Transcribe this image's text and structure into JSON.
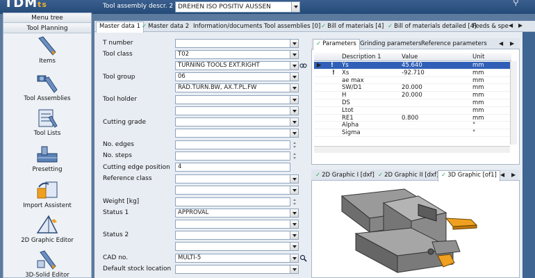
{
  "app": {
    "logo": "TDM",
    "logo_sub": "ts"
  },
  "header": {
    "assembly_label": "Tool assembly descr. 2",
    "assembly_value": "DREHEN ISO POSITIV AUSSEN"
  },
  "sidebar": {
    "menu_tree": "Menu tree",
    "section": "Tool Planning",
    "items": [
      {
        "label": "Items",
        "icon": "drill-bit-icon"
      },
      {
        "label": "Tool Assemblies",
        "icon": "tool-assembly-icon"
      },
      {
        "label": "Tool Lists",
        "icon": "tool-list-icon"
      },
      {
        "label": "Presetting",
        "icon": "presetting-icon"
      },
      {
        "label": "Import Assistent",
        "icon": "import-icon"
      },
      {
        "label": "2D Graphic Editor",
        "icon": "graphic-editor-icon"
      },
      {
        "label": "3D-Solid Editor",
        "icon": "solid-editor-icon"
      }
    ]
  },
  "tabs": [
    {
      "label": "Master data 1",
      "active": true
    },
    {
      "label": "Master data 2",
      "checked": true
    },
    {
      "label": "Information/documents"
    },
    {
      "label": "Tool assemblies [0]"
    },
    {
      "label": "Bill of materials [4]",
      "checked": true
    },
    {
      "label": "Bill of materials detailed [4]",
      "checked": true
    },
    {
      "label": "Feeds & spe"
    }
  ],
  "form": {
    "t_number": {
      "label": "T number",
      "value": ""
    },
    "tool_class": {
      "label": "Tool class",
      "value": "T02",
      "value2": "TURNING TOOLS EXT.RIGHT"
    },
    "tool_group": {
      "label": "Tool group",
      "value": "06",
      "value2": "RAD.TURN.BW, AX.T.PL.FW"
    },
    "tool_holder": {
      "label": "Tool holder"
    },
    "cutting_grade": {
      "label": "Cutting grade"
    },
    "no_edges": {
      "label": "No. edges"
    },
    "no_steps": {
      "label": "No. steps"
    },
    "cutting_edge_position": {
      "label": "Cutting edge position",
      "value": "4"
    },
    "reference_class": {
      "label": "Reference class"
    },
    "weight": {
      "label": "Weight [kg]"
    },
    "status1": {
      "label": "Status 1",
      "value": "APPROVAL"
    },
    "status2": {
      "label": "Status 2"
    },
    "cad_no": {
      "label": "CAD no.",
      "value": "MULTI-5"
    },
    "default_stock_location": {
      "label": "Default stock location"
    }
  },
  "params": {
    "tabs": [
      "Parameters",
      "Grinding parameters",
      "Reference parameters"
    ],
    "columns": [
      "Description 1",
      "Value",
      "Unit"
    ],
    "rows": [
      {
        "desc": "Ys",
        "value": "45.640",
        "unit": "mm",
        "selected": true
      },
      {
        "desc": "Xs",
        "value": "-92.710",
        "unit": "mm"
      },
      {
        "desc": "ae max",
        "value": "",
        "unit": "mm"
      },
      {
        "desc": "SW/D1",
        "value": "20.000",
        "unit": "mm"
      },
      {
        "desc": "H",
        "value": "20.000",
        "unit": "mm"
      },
      {
        "desc": "DS",
        "value": "",
        "unit": "mm"
      },
      {
        "desc": "Ltot",
        "value": "",
        "unit": "mm"
      },
      {
        "desc": "RE1",
        "value": "0.800",
        "unit": "mm"
      },
      {
        "desc": "Alpha",
        "value": "",
        "unit": "°"
      },
      {
        "desc": "Sigma",
        "value": "",
        "unit": "°"
      }
    ]
  },
  "graphic": {
    "tabs": [
      "2D Graphic I [dxf]",
      "2D Graphic  II [dxf]",
      "3D Graphic [of1]"
    ]
  },
  "colors": {
    "accent": "#244a78",
    "selection": "#2f5fb7",
    "insert": "#f0a020"
  }
}
